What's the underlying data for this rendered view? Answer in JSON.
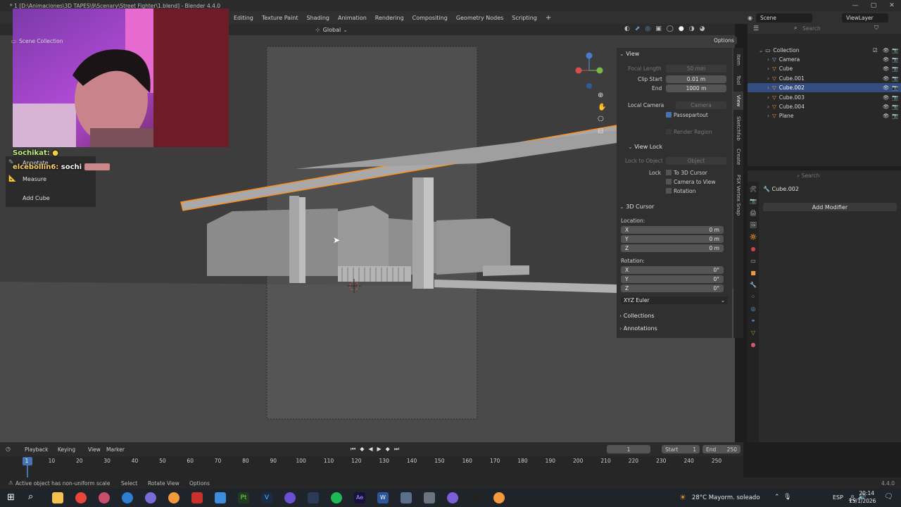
{
  "window": {
    "title": "* 1 [D:\\Animaciones\\3D TAPES\\9\\Scenary\\Street Fighter\\1.blend] - Blender 4.4.0",
    "controls": [
      "—",
      "▢",
      "✕"
    ]
  },
  "workspaces": [
    "Editing",
    "Texture Paint",
    "Shading",
    "Animation",
    "Rendering",
    "Compositing",
    "Geometry Nodes",
    "Scripting",
    "+"
  ],
  "scene": {
    "label": "Scene",
    "view_layer": "ViewLayer"
  },
  "viewport_header": {
    "orientation": "Global",
    "options_label": "Options"
  },
  "stream": {
    "chat1_user": "Sochikat:",
    "chat2_user": "elceboll in6:",
    "chat2_user_display": "elcebollin6:",
    "chat2_text": "sochi"
  },
  "tools": {
    "annotate": "Annotate",
    "measure": "Measure",
    "add_cube": "Add Cube"
  },
  "npanel": {
    "view_header": "View",
    "focal_length_label": "Focal Length",
    "focal_length": "50 mm",
    "clip_start_label": "Clip Start",
    "clip_start": "0.01 m",
    "clip_end_label": "End",
    "clip_end": "1000 m",
    "local_camera_label": "Local Camera",
    "local_camera_value": "Camera",
    "passepartout": "Passepartout",
    "render_region": "Render Region",
    "view_lock_header": "View Lock",
    "lock_to_object_label": "Lock to Object",
    "lock_to_object_value": "Object",
    "lock_label": "Lock",
    "to_3d_cursor": "To 3D Cursor",
    "camera_to_view": "Camera to View",
    "rotation_lock": "Rotation",
    "cursor_header": "3D Cursor",
    "location_label": "Location:",
    "x": "X",
    "y": "Y",
    "z": "Z",
    "loc_x": "0 m",
    "loc_y": "0 m",
    "loc_z": "0 m",
    "rotation_label": "Rotation:",
    "rot_x": "0°",
    "rot_y": "0°",
    "rot_z": "0°",
    "rotation_mode": "XYZ Euler",
    "collections": "Collections",
    "annotations": "Annotations"
  },
  "vtabs": [
    "Item",
    "Tool",
    "View",
    "Sketchfab",
    "Create",
    "PSX Vertex Snap"
  ],
  "outliner": {
    "root": "Scene Collection",
    "collection": "Collection",
    "items": [
      "Camera",
      "Cube",
      "Cube.001",
      "Cube.002",
      "Cube.003",
      "Cube.004",
      "Plane"
    ],
    "selected_index": 3
  },
  "properties": {
    "object_name": "Cube.002",
    "add_modifier": "Add Modifier",
    "search_placeholder": "Search"
  },
  "timeline": {
    "playback": "Playback",
    "keying": "Keying",
    "view": "View",
    "marker": "Marker",
    "current_frame": "1",
    "start_label": "Start",
    "start": "1",
    "end_label": "End",
    "end": "250",
    "ticks": [
      "1",
      "10",
      "20",
      "30",
      "40",
      "50",
      "60",
      "70",
      "80",
      "90",
      "100",
      "110",
      "120",
      "130",
      "140",
      "150",
      "160",
      "170",
      "180",
      "190",
      "200",
      "210",
      "220",
      "230",
      "240",
      "250"
    ]
  },
  "status": {
    "message": "Active object has non-uniform scale",
    "select": "Select",
    "rotate_view": "Rotate View",
    "options": "Options",
    "version": "4.4.0"
  },
  "taskbar": {
    "weather": "28°C  Mayorm. soleado",
    "lang": "ESP",
    "time": "20:14",
    "date": "15/1/2026"
  },
  "colors": {
    "accent_blue": "#4772b3",
    "selected_row": "#334d80",
    "orange_select": "#ff8c1a"
  }
}
